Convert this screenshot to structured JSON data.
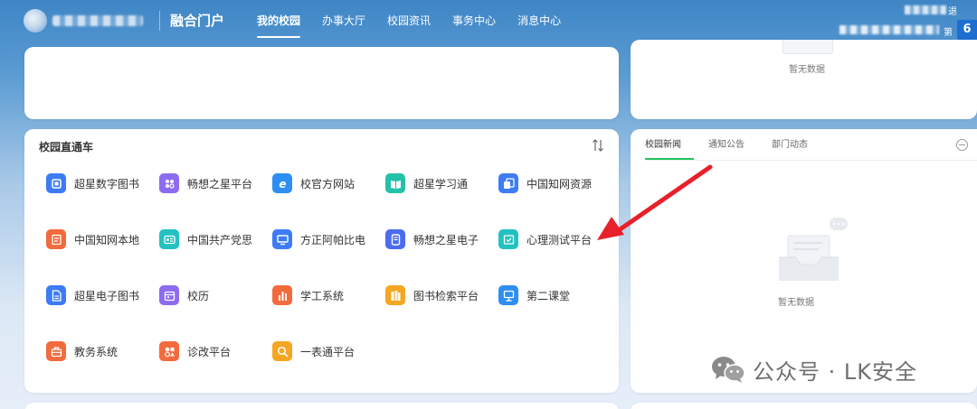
{
  "header": {
    "portal_title": "融合门户",
    "nav_tabs": [
      {
        "label": "我的校园",
        "active": true
      },
      {
        "label": "办事大厅",
        "active": false
      },
      {
        "label": "校园资讯",
        "active": false
      },
      {
        "label": "事务中心",
        "active": false
      },
      {
        "label": "消息中心",
        "active": false
      }
    ],
    "user_label_a": "退",
    "user_label_b": "第",
    "week_number": "6"
  },
  "top_right_card": {
    "empty_text": "暂无数据"
  },
  "shortcut_section": {
    "title": "校园直通车",
    "items": [
      {
        "label": "超星数字图书",
        "color": "#3d7cf5",
        "icon": "book-icon"
      },
      {
        "label": "畅想之星平台",
        "color": "#8c6cf0",
        "icon": "grid-dots-icon"
      },
      {
        "label": "校官方网站",
        "color": "#2e8ef2",
        "icon": "browser-e-icon"
      },
      {
        "label": "超星学习通",
        "color": "#24c1a8",
        "icon": "open-book-icon"
      },
      {
        "label": "中国知网资源",
        "color": "#3d7cf5",
        "icon": "documents-icon"
      },
      {
        "label": "中国知网本地",
        "color": "#f26b3d",
        "icon": "document-list-icon"
      },
      {
        "label": "中国共产党思",
        "color": "#24c1c1",
        "icon": "id-card-icon"
      },
      {
        "label": "方正阿帕比电",
        "color": "#3d7cf5",
        "icon": "monitor-icon"
      },
      {
        "label": "畅想之星电子",
        "color": "#4a6cf0",
        "icon": "ebook-icon"
      },
      {
        "label": "心理测试平台",
        "color": "#24c1c1",
        "icon": "test-paper-icon"
      },
      {
        "label": "超星电子图书",
        "color": "#3d7cf5",
        "icon": "file-icon"
      },
      {
        "label": "校历",
        "color": "#8c6cf0",
        "icon": "calendar-icon"
      },
      {
        "label": "学工系统",
        "color": "#f26b3d",
        "icon": "bars-icon"
      },
      {
        "label": "图书检索平台",
        "color": "#f5a623",
        "icon": "books-shelf-icon"
      },
      {
        "label": "第二课堂",
        "color": "#2e8ef2",
        "icon": "classroom-icon"
      },
      {
        "label": "教务系统",
        "color": "#f26b3d",
        "icon": "briefcase-icon"
      },
      {
        "label": "诊改平台",
        "color": "#f26b3d",
        "icon": "shapes-icon"
      },
      {
        "label": "一表通平台",
        "color": "#f5a623",
        "icon": "search-magnifier-icon"
      }
    ]
  },
  "news_section": {
    "tabs": [
      {
        "label": "校园新闻",
        "active": true
      },
      {
        "label": "通知公告",
        "active": false
      },
      {
        "label": "部门动态",
        "active": false
      }
    ],
    "empty_text": "暂无数据"
  },
  "watermark": {
    "text": "公众号 · LK安全"
  },
  "annotation": {
    "arrow_color": "#e8202a"
  }
}
